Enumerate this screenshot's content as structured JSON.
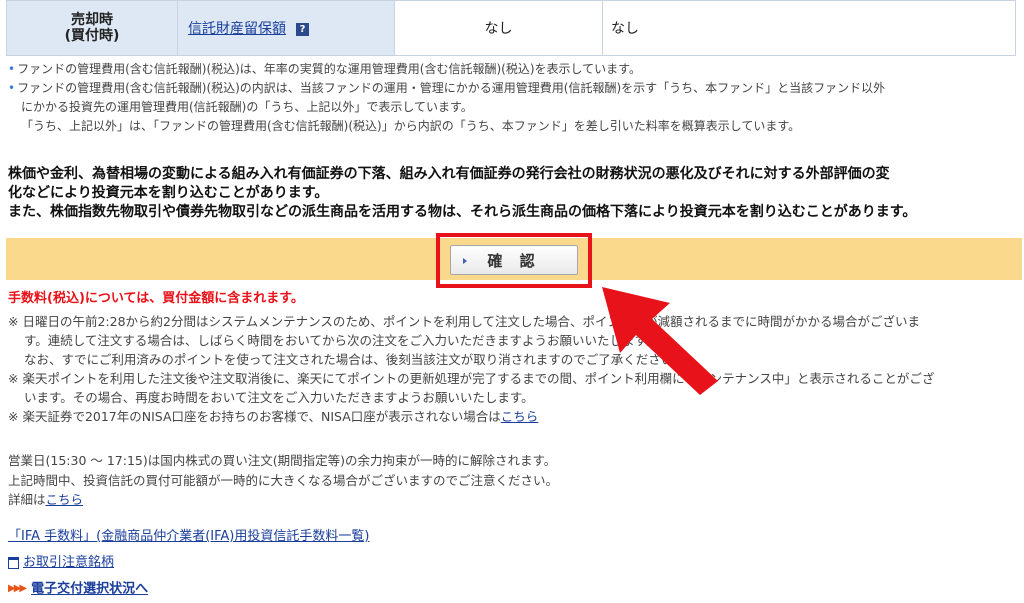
{
  "table": {
    "label": "売却時\n(買付時)",
    "name_link": "信託財産留保額",
    "help_icon": "?",
    "value1": "なし",
    "value2": "なし"
  },
  "notes": [
    "ファンドの管理費用(含む信託報酬)(税込)は、年率の実質的な運用管理費用(含む信託報酬)(税込)を表示しています。",
    "ファンドの管理費用(含む信託報酬)(税込)の内訳は、当該ファンドの運用・管理にかかる運用管理費用(信託報酬)を示す「うち、本ファンド」と当該ファンド以外",
    "にかかる投資先の運用管理費用(信託報酬)の「うち、上記以外」で表示しています。",
    "「うち、上記以外」は、「ファンドの管理費用(含む信託報酬)(税込)」から内訳の「うち、本ファンド」を差し引いた料率を概算表示しています。"
  ],
  "warning": [
    "株価や金利、為替相場の変動による組み入れ有価証券の下落、組み入れ有価証券の発行会社の財務状況の悪化及びそれに対する外部評価の変",
    "化などにより投資元本を割り込むことがあります。",
    "また、株価指数先物取引や債券先物取引などの派生商品を活用する物は、それら派生商品の価格下落により投資元本を割り込むことがあります。"
  ],
  "confirm_button": "確 認",
  "fee_note": "手数料(税込)については、買付金額に含まれます。",
  "bottom_notes": [
    "※  日曜日の午前2:28から約2分間はシステムメンテナンスのため、ポイントを利用して注文した場合、ポイント数が減額されるまでに時間がかかる場合がございま",
    "す。連続して注文する場合は、しばらく時間をおいてから次の注文をご入力いただきますようお願いいたします。",
    "なお、すでにご利用済みのポイントを使って注文された場合は、後刻当該注文が取り消されますのでご了承ください。",
    "※  楽天ポイントを利用した注文後や注文取消後に、楽天にてポイントの更新処理が完了するまでの間、ポイント利用欄に「メンテナンス中」と表示されることがござ",
    "います。その場合、再度お時間をおいて注文をご入力いただきますようお願いいたします。",
    "※  楽天証券で2017年のNISA口座をお持ちのお客様で、NISA口座が表示されない場合は"
  ],
  "nisa_link": "こちら",
  "info": [
    "営業日(15:30 〜 17:15)は国内株式の買い注文(期間指定等)の余力拘束が一時的に解除されます。",
    "上記時間中、投資信託の買付可能額が一時的に大きくなる場合がございますのでご注意ください。",
    "詳細は"
  ],
  "detail_link": "こちら",
  "links": {
    "ifa": "「IFA 手数料」(金融商品仲介業者(IFA)用投資信託手数料一覧)",
    "caution": "お取引注意銘柄",
    "edelivery": "電子交付選択状況へ"
  },
  "colors": {
    "accent_red": "#e8131a",
    "link": "#1a3e9c",
    "bar": "#fbd98c"
  }
}
